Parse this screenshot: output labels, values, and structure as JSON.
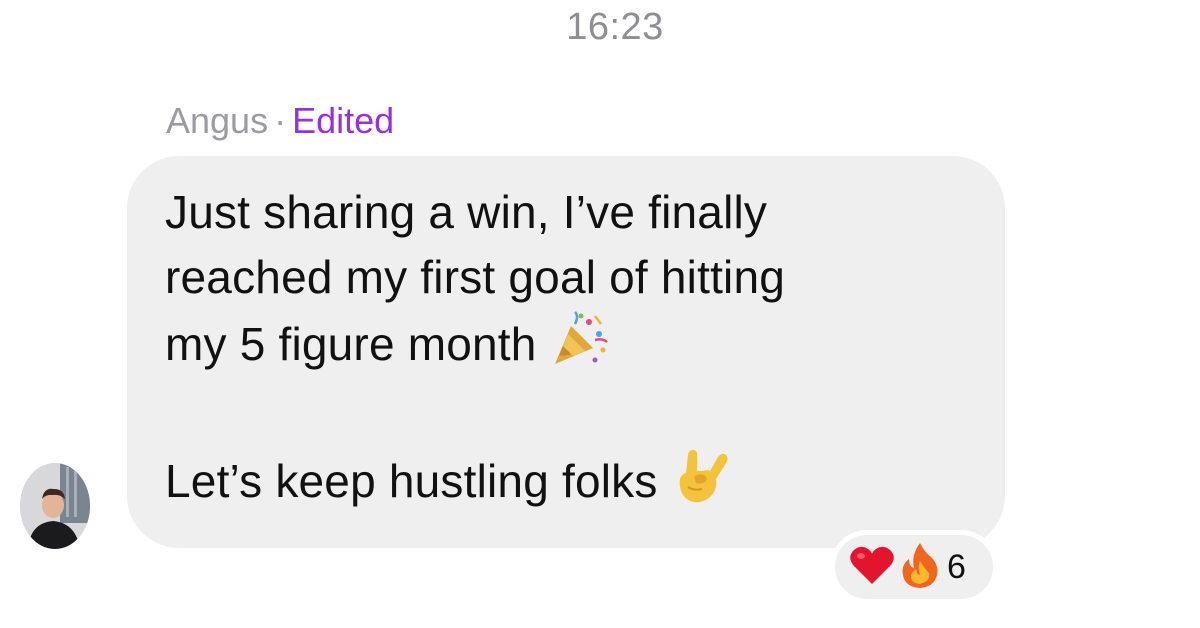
{
  "header": {
    "timestamp": "16:23"
  },
  "message": {
    "sender": "Angus",
    "separator": "·",
    "edited_label": "Edited",
    "lines": [
      "Just sharing a win, I’ve finally",
      "reached my first goal of hitting",
      "my 5 figure month",
      "Let’s keep hustling folks"
    ],
    "emojis": [
      "party-popper-icon",
      "sign-of-the-horns-icon"
    ]
  },
  "reactions": {
    "icons": [
      "red-heart-icon",
      "fire-icon"
    ],
    "count": "6"
  },
  "colors": {
    "bubble": "#efefef",
    "edited": "#9a2fe0",
    "muted_text": "#9b9ba0"
  }
}
